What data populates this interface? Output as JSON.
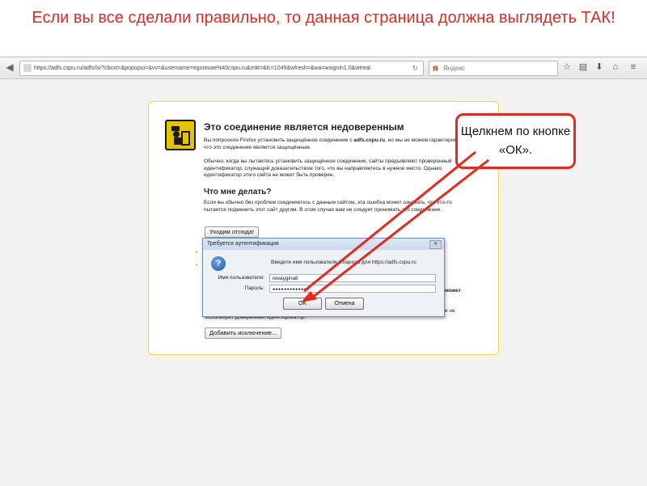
{
  "slide": {
    "title": "Если вы все сделали правильно, то данная страница должна выглядеть ТАК!"
  },
  "browser": {
    "url": "https://adfs.cspu.ru/adfs/ls/?cbcxt=&popupui=&vv=&username=egorovae%40cspu.ru&mkt=&lc=1049&wfresh=&wa=wsignin1.0&wtreal",
    "search_placeholder": "Яндекс",
    "icons": [
      "back-icon",
      "forward-icon",
      "site-info-icon",
      "reload-icon",
      "star-icon",
      "reading-list-icon",
      "download-icon",
      "home-icon",
      "menu-icon"
    ]
  },
  "cert_page": {
    "title": "Это соединение является недоверенным",
    "para1_a": "Вы попросили Firefox установить защищённое соединение с ",
    "para1_host": "adfs.cspu.ru",
    "para1_b": ", но мы не можем гарантировать, что это соединение является защищённым.",
    "para2": "Обычно, когда вы пытаетесь установить защищённое соединение, сайты предъявляют проверенный идентификатор, служащий доказательством того, что вы направляетесь в нужное место. Однако идентификатор этого сайта не может быть проверен.",
    "heading2": "Что мне делать?",
    "para3": "Если вы обычно без проблем соединяетесь с данным сайтом, эта ошибка может означать, что кто-то пытается подменить этот сайт другим. В этом случае вам не следует принимать это соединение.",
    "leave_button": "Уходим отсюда!",
    "hidden_bold": "может",
    "hidden_text_a": "е не",
    "hidden_text_b": "используют доверенный идентификатор.",
    "add_exception_button": "Добавить исключение..."
  },
  "auth_dialog": {
    "title": "Требуется аутентификация",
    "prompt": "Введите имя пользователя и пароль для https://adfs.cspu.ru",
    "username_label": "Имя пользователя:",
    "username_value": "revayginatl",
    "password_label": "Пароль:",
    "password_value": "●●●●●●●●●●●●●",
    "ok_button": "OK",
    "cancel_button": "Отмена",
    "close_glyph": "✕"
  },
  "callout": {
    "text": "Щелкнем по кнопке «ОК»."
  },
  "colors": {
    "accent_red": "#e8281e",
    "panel_border": "#e6d47a",
    "warning_yellow": "#e6c300"
  }
}
